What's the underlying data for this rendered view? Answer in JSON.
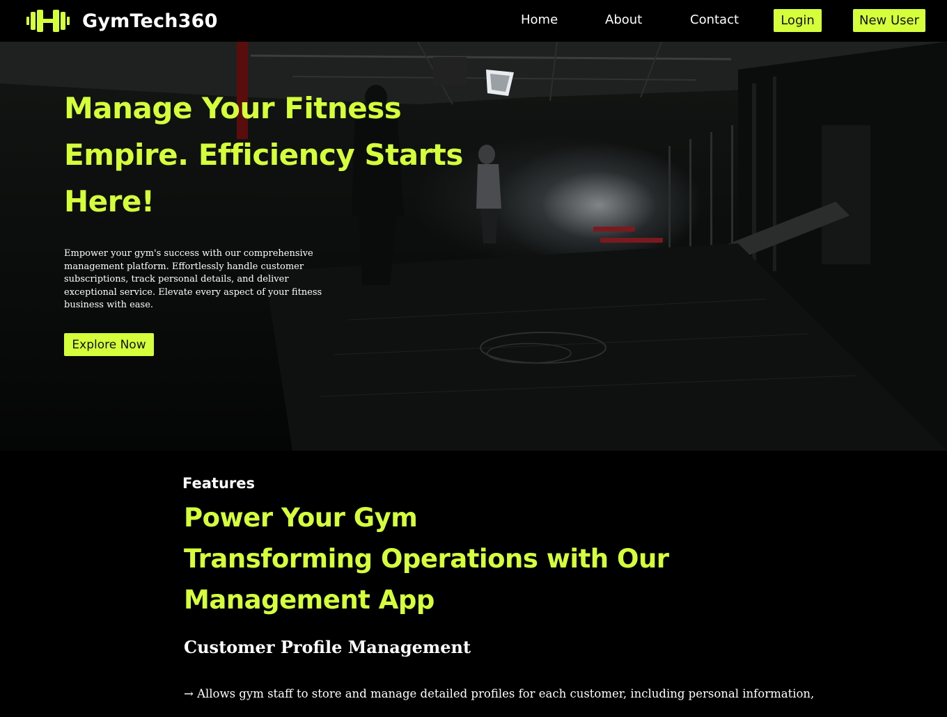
{
  "navbar": {
    "brand_name": "GymTech360",
    "links": [
      "Home",
      "About",
      "Contact"
    ],
    "login_label": "Login",
    "new_user_label": "New User",
    "accent_color": "#d4ff3a"
  },
  "hero": {
    "title_lines": [
      "Manage Your Fitness",
      "Empire. Efficiency Starts",
      "Here!"
    ],
    "description": "Empower your gym's success with our comprehensive management platform. Effortlessly handle customer subscriptions, track personal details, and deliver exceptional service. Elevate every aspect of your fitness business with ease.",
    "cta_label": "Explore Now"
  },
  "features": {
    "label": "Features",
    "heading_lines": [
      "Power Your Gym",
      "Transforming Operations with Our",
      "Management App"
    ],
    "item_title": "Customer Profile Management",
    "item_desc": "→ Allows gym staff to store and manage detailed profiles for each customer, including personal information,"
  }
}
